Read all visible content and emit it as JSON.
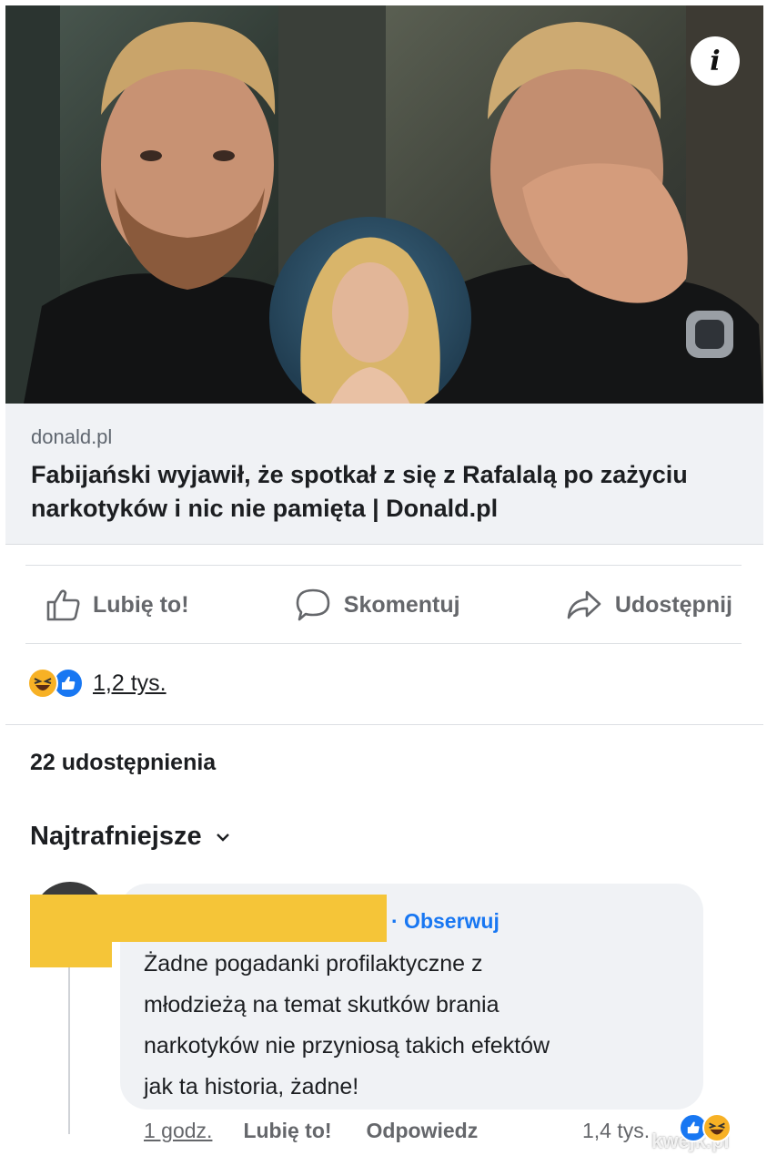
{
  "preview": {
    "info_icon": "i",
    "icons": [
      "info-icon"
    ]
  },
  "link": {
    "domain": "donald.pl",
    "title": "Fabijański wyjawił, że spotkał z się z Rafalalą po zażyciu narkotyków i nic nie pamięta | Donald.pl"
  },
  "actions": {
    "like_label": "Lubię to!",
    "comment_label": "Skomentuj",
    "share_label": "Udostępnij"
  },
  "reactions": {
    "count": "1,2 tys."
  },
  "shares": {
    "label": "22 udostępnienia"
  },
  "sort": {
    "label": "Najtrafniejsze"
  },
  "comment": {
    "follow_label": "· Obserwuj",
    "text": "Żadne pogadanki profilaktyczne z\nmłodzieżą na temat skutków brania\nnarkotyków nie przyniosą takich efektów\njak ta historia, żadne!",
    "time": "1 godz.",
    "like_label": "Lubię to!",
    "reply_label": "Odpowiedz",
    "reaction_count": "1,4 tys."
  },
  "watermark": "kwejk.pl",
  "colors": {
    "accent": "#1877f2",
    "caption_bg": "#f0f2f5",
    "redaction": "#f5c538",
    "haha": "#f7b125"
  }
}
